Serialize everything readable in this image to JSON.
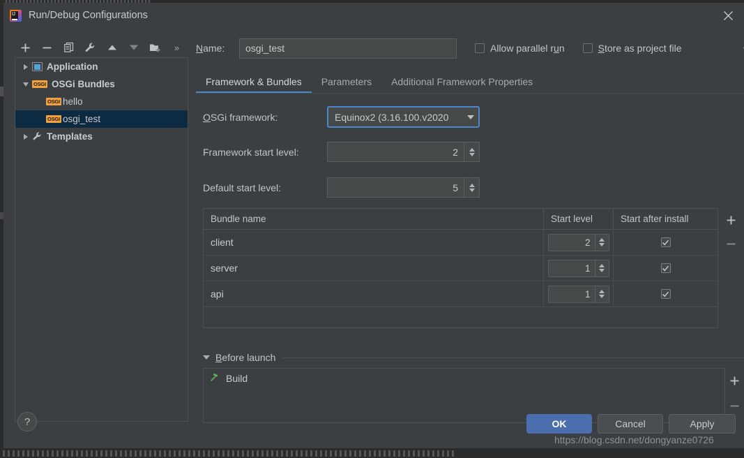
{
  "window": {
    "title": "Run/Debug Configurations",
    "logo_icon": "intellij-idea-logo-icon",
    "close_icon": "close-icon"
  },
  "toolbar": {
    "buttons": [
      {
        "name": "add-configuration-button",
        "icon": "plus-icon"
      },
      {
        "name": "remove-configuration-button",
        "icon": "minus-icon"
      },
      {
        "name": "copy-configuration-button",
        "icon": "copy-icon"
      },
      {
        "name": "edit-templates-button",
        "icon": "wrench-icon"
      },
      {
        "name": "move-up-button",
        "icon": "triangle-up-icon"
      },
      {
        "name": "move-down-button",
        "icon": "triangle-down-icon"
      },
      {
        "name": "new-folder-button",
        "icon": "folder-add-icon"
      },
      {
        "name": "more-options-button",
        "icon": "chevron-double-right-icon",
        "glyph": "»"
      }
    ]
  },
  "tree": {
    "items": [
      {
        "label": "Application",
        "icon": "application-icon",
        "twisty": "collapsed",
        "indent": 0,
        "bold": true,
        "selected": false
      },
      {
        "label": "OSGi Bundles",
        "icon": "osgi-icon",
        "twisty": "expanded",
        "indent": 0,
        "bold": true,
        "selected": false
      },
      {
        "label": "hello",
        "icon": "osgi-icon",
        "twisty": "none",
        "indent": 1,
        "bold": false,
        "selected": false
      },
      {
        "label": "osgi_test",
        "icon": "osgi-icon",
        "twisty": "none",
        "indent": 1,
        "bold": false,
        "selected": true
      },
      {
        "label": "Templates",
        "icon": "wrench-icon",
        "twisty": "collapsed",
        "indent": 0,
        "bold": true,
        "selected": false
      }
    ],
    "osgi_badge_text": "OSGI"
  },
  "name_row": {
    "label_prefix": "N",
    "label_rest": "ame:",
    "value": "osgi_test",
    "placeholder": "",
    "allow_parallel": {
      "label_a": "Allow parallel r",
      "label_u": "u",
      "label_b": "n",
      "checked": false
    },
    "store_project_file": {
      "label_s": "S",
      "label_rest": "tore as project file",
      "checked": false
    },
    "edge_glyph": "?"
  },
  "tabs": [
    {
      "label": "Framework & Bundles",
      "active": true
    },
    {
      "label": "Parameters",
      "active": false
    },
    {
      "label": "Additional Framework Properties",
      "active": false
    }
  ],
  "form": {
    "framework": {
      "label_o": "O",
      "label_rest": "SGi framework:",
      "value": "Equinox2 (3.16.100.v2020",
      "focused": true
    },
    "framework_start_level": {
      "label": "Framework start level:",
      "value": "2"
    },
    "default_start_level": {
      "label": "Default start level:",
      "value": "5"
    }
  },
  "bundles_table": {
    "columns": [
      "Bundle name",
      "Start level",
      "Start after install"
    ],
    "rows": [
      {
        "bundle_name": "client",
        "start_level": "2",
        "start_after_install": true
      },
      {
        "bundle_name": "server",
        "start_level": "1",
        "start_after_install": true
      },
      {
        "bundle_name": "api",
        "start_level": "1",
        "start_after_install": true
      }
    ],
    "add_button": {
      "name": "add-bundle-button",
      "icon": "plus-icon"
    },
    "remove_button": {
      "name": "remove-bundle-button",
      "icon": "minus-icon"
    }
  },
  "before_launch": {
    "title_b": "B",
    "title_rest": "efore launch",
    "expanded": true,
    "items": [
      {
        "label": "Build",
        "icon": "hammer-icon"
      }
    ],
    "add_button": {
      "name": "add-before-launch-task-button",
      "icon": "plus-icon"
    },
    "remove_button": {
      "name": "remove-before-launch-task-button",
      "icon": "minus-icon"
    }
  },
  "footer": {
    "help_glyph": "?",
    "buttons": [
      {
        "label": "OK",
        "primary": true
      },
      {
        "label": "Cancel",
        "primary": false
      },
      {
        "label": "Apply",
        "primary": false
      }
    ]
  },
  "watermark": {
    "text": "https://blog.csdn.net/dongyanze0726"
  },
  "colors": {
    "dialog_bg": "#3c3f41",
    "field_bg": "#45494a",
    "accent_blue": "#4a88c7",
    "selection_bg": "#0d2a43",
    "primary_button": "#4b6eaf",
    "osgi_badge": "#f2a13c",
    "hammer_green": "#60b060",
    "text": "#c8cacb"
  }
}
